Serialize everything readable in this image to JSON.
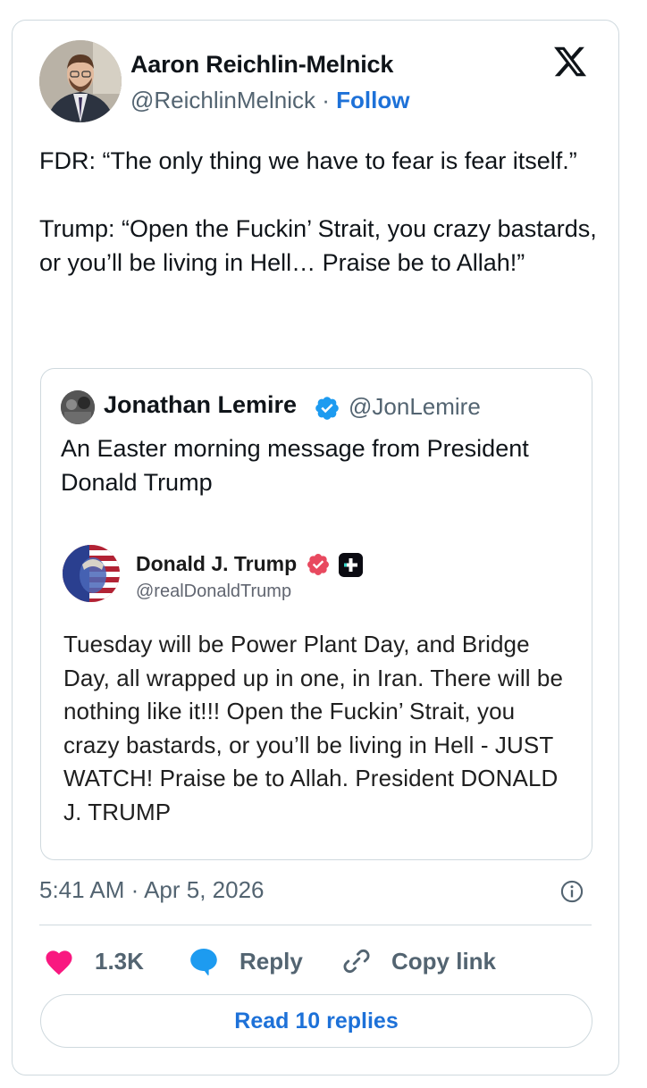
{
  "author": {
    "name": "Aaron Reichlin-Melnick",
    "handle": "@ReichlinMelnick",
    "separator": "·",
    "follow_label": "Follow",
    "platform_icon": "x-logo-icon"
  },
  "tweet": {
    "text": "FDR: “The only thing we have to fear is fear itself.”\n\nTrump: “Open the Fuckin’ Strait, you crazy bastards, or you’ll be living in Hell… Praise be to Allah!”",
    "timestamp": "5:41 AM · Apr 5, 2026"
  },
  "quoted": {
    "name": "Jonathan Lemire",
    "handle": "@JonLemire",
    "verified": true,
    "text": "An Easter morning message from President Donald Trump"
  },
  "embedded_post": {
    "name": "Donald J. Trump",
    "handle": "@realDonaldTrump",
    "text": "Tuesday will be Power Plant Day, and Bridge Day, all wrapped up in one, in Iran. There will be nothing like it!!! Open the Fuckin’ Strait, you crazy bastards, or you’ll be living in Hell - JUST WATCH! Praise be to Allah. President DONALD J. TRUMP"
  },
  "actions": {
    "like_count": "1.3K",
    "reply_label": "Reply",
    "copy_link_label": "Copy link",
    "read_replies_label": "Read 10 replies"
  },
  "colors": {
    "accent": "#1d71d8",
    "like": "#f91880",
    "verified": "#1d9bf0",
    "secondary_text": "#536471",
    "border": "#cfd9de"
  }
}
